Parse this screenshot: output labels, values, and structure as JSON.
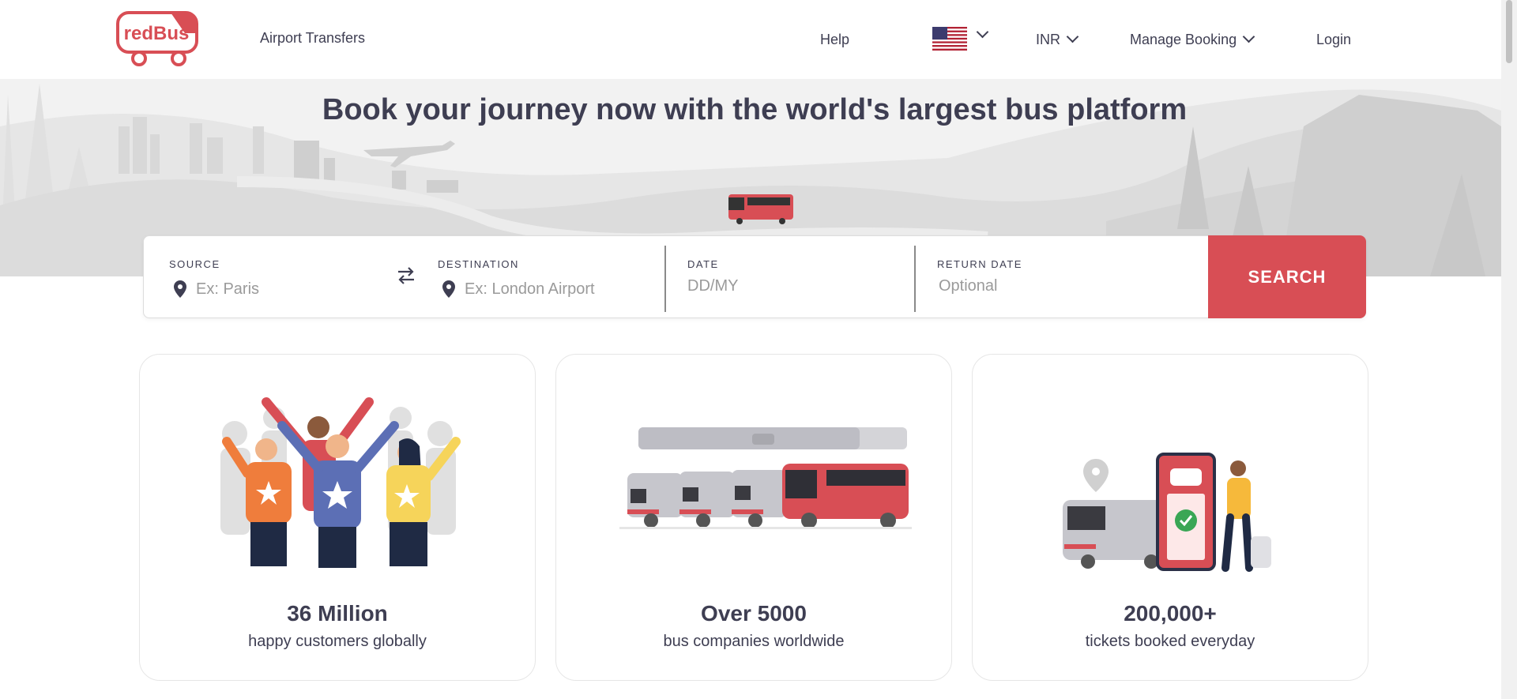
{
  "header": {
    "logo_text": "redBus",
    "nav_airport": "Airport Transfers",
    "nav_help": "Help",
    "currency": "INR",
    "manage_booking": "Manage Booking",
    "login": "Login",
    "flag_icon": "us-flag-icon"
  },
  "hero": {
    "title": "Book your journey now with the world's largest bus platform"
  },
  "search": {
    "source_label": "SOURCE",
    "source_placeholder": "Ex: Paris",
    "destination_label": "DESTINATION",
    "destination_placeholder": "Ex: London Airport",
    "date_label": "DATE",
    "date_placeholder": "DD/MY",
    "return_label": "RETURN DATE",
    "return_placeholder": "Optional",
    "button": "SEARCH"
  },
  "stats": [
    {
      "value": "36 Million",
      "desc": "happy customers globally",
      "icon": "happy-customers-illustration"
    },
    {
      "value": "Over 5000",
      "desc": "bus companies worldwide",
      "icon": "bus-fleet-illustration"
    },
    {
      "value": "200,000+",
      "desc": "tickets booked everyday",
      "icon": "ticket-booking-illustration"
    }
  ],
  "colors": {
    "brand_red": "#d84e55",
    "text_dark": "#3e3e52",
    "hero_bg": "#f2f2f2"
  }
}
